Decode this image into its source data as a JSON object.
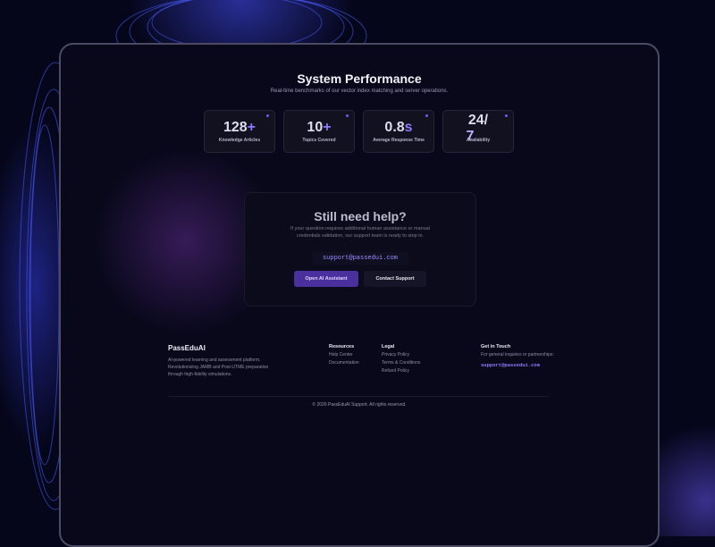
{
  "performance": {
    "title": "System Performance",
    "subtitle": "Real-time benchmarks of our vector index matching and server operations.",
    "stats": [
      {
        "number": "128",
        "suffix": "+",
        "label": "Knowledge Articles"
      },
      {
        "number": "10",
        "suffix": "+",
        "label": "Topics Covered"
      },
      {
        "number": "0.8",
        "suffix": "s",
        "label": "Average Response Time"
      },
      {
        "number": "24/",
        "suffix": "7",
        "label": "Availability"
      }
    ]
  },
  "help": {
    "title": "Still need help?",
    "description": "If your question requires additional human assistance or manual credentials validation, our support team is ready to step in.",
    "email": "support@passedui.com",
    "ai_button": "Open AI Assistant",
    "contact_button": "Contact Support"
  },
  "footer": {
    "brand": "PassEduAI",
    "description": "AI-powered learning and assessment platform. Revolutionizing JAMB and Post-UTME preparation through high-fidelity simulations.",
    "resources_heading": "Resources",
    "resources": [
      "Help Center",
      "Documentation"
    ],
    "legal_heading": "Legal",
    "legal": [
      "Privacy Policy",
      "Terms & Conditions",
      "Refund Policy"
    ],
    "contact_heading": "Get in Touch",
    "contact_text": "For general inquiries or partnerships:",
    "contact_email": "support@passedui.com",
    "copyright": "© 2026 PassEduAI Support. All rights reserved."
  },
  "colors": {
    "accent": "#8e7bff",
    "primary_button": "#4a2f9e",
    "background": "#05061a"
  }
}
